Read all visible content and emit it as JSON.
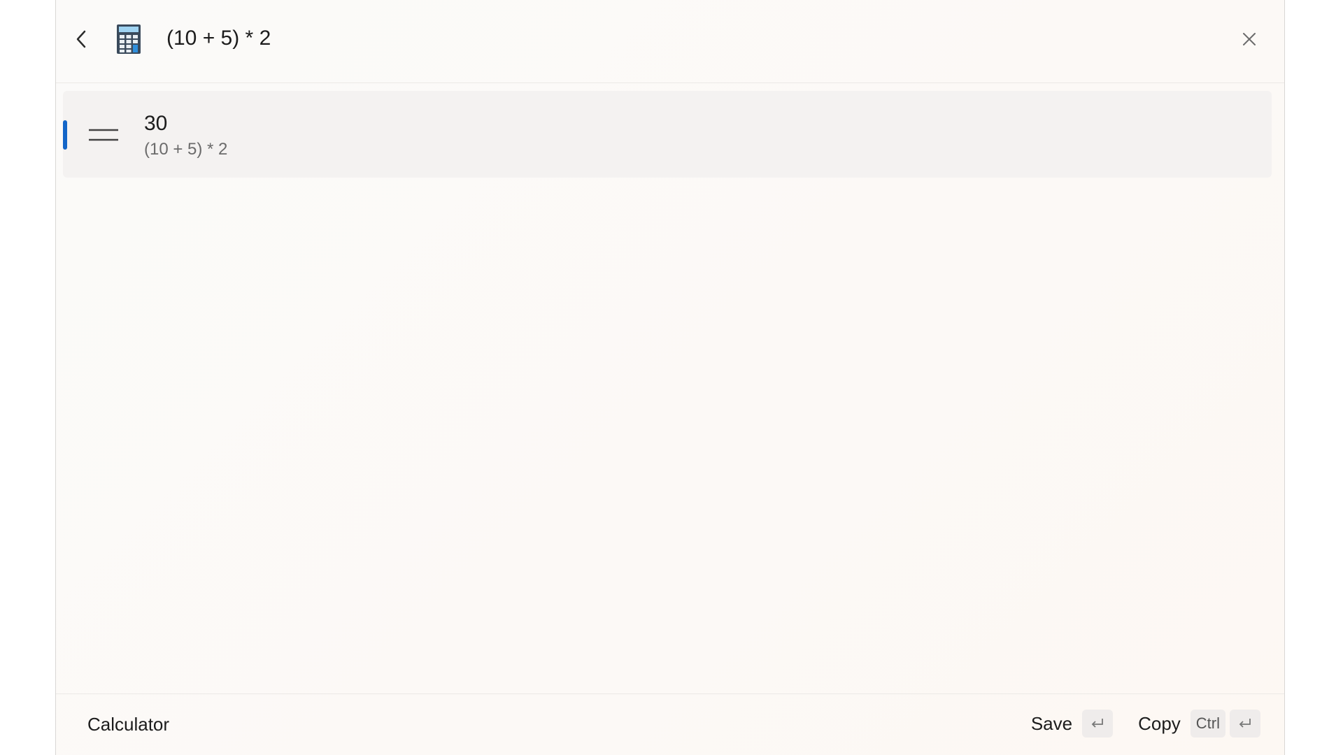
{
  "header": {
    "back_icon": "chevron-left-icon",
    "app_icon": "calculator-icon",
    "query": "(10 + 5) * 2",
    "close_icon": "close-icon"
  },
  "results": [
    {
      "icon": "equals-icon",
      "value": "30",
      "expression": "(10 + 5) * 2",
      "selected": true
    }
  ],
  "footer": {
    "app_name": "Calculator",
    "save_label": "Save",
    "save_key_icon": "enter-key-icon",
    "copy_label": "Copy",
    "copy_modifier": "Ctrl",
    "copy_key_icon": "enter-key-icon"
  },
  "colors": {
    "accent": "#1466c8",
    "selected_bg": "#f4f2f1",
    "text_primary": "#1c1c1c",
    "text_secondary": "#6b6b6b"
  }
}
